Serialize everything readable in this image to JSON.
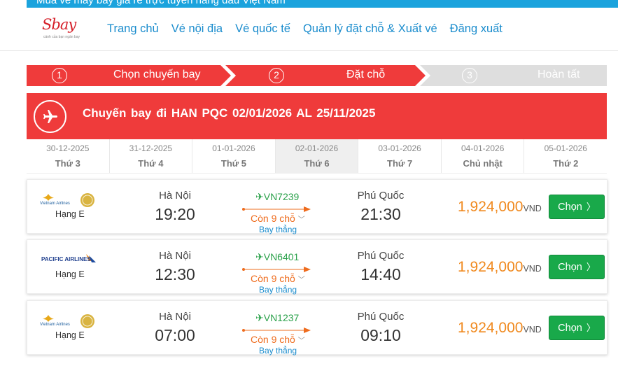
{
  "top_strip": {
    "text": "Mua vé máy bay giá rẻ trực tuyến hàng đầu Việt Nam"
  },
  "header": {
    "logo_text": "Sbay",
    "logo_sub": "cánh của bạn ngàn bay",
    "nav": [
      "Trang chủ",
      "Vé nội địa",
      "Vé quốc tế",
      "Quản lý đặt chỗ & Xuất vé",
      "Đăng xuất"
    ]
  },
  "steps": [
    {
      "num": "1",
      "label": "Chọn chuyến bay",
      "state": "active"
    },
    {
      "num": "2",
      "label": "Đặt chỗ",
      "state": "active"
    },
    {
      "num": "3",
      "label": "Hoàn tất",
      "state": "inactive"
    }
  ],
  "banner": {
    "title": "Chuyến bay đi HAN  PQC  02/01/2026  AL 25/11/2025"
  },
  "dates": [
    {
      "date": "30-12-2025",
      "weekday": "Thứ 3",
      "active": false
    },
    {
      "date": "31-12-2025",
      "weekday": "Thứ 4",
      "active": false
    },
    {
      "date": "01-01-2026",
      "weekday": "Thứ 5",
      "active": false
    },
    {
      "date": "02-01-2026",
      "weekday": "Thứ 6",
      "active": true
    },
    {
      "date": "03-01-2026",
      "weekday": "Thứ 7",
      "active": false
    },
    {
      "date": "04-01-2026",
      "weekday": "Chủ nhật",
      "active": false
    },
    {
      "date": "05-01-2026",
      "weekday": "Thứ 2",
      "active": false
    }
  ],
  "flights": [
    {
      "airline": "Vietnam Airlines",
      "logo": "vietnam-airlines-logo",
      "class": "Hạng E",
      "from": "Hà Nội",
      "dep_time": "19:20",
      "code": "VN7239",
      "seats": "Còn 9 chỗ",
      "stops": "Bay thẳng",
      "to": "Phú Quốc",
      "arr_time": "21:30",
      "price": "1,924,000",
      "currency": "VND",
      "button": "Chọn"
    },
    {
      "airline": "Pacific Airlines",
      "logo": "pacific-airlines-logo",
      "class": "Hạng E",
      "from": "Hà Nội",
      "dep_time": "12:30",
      "code": "VN6401",
      "seats": "Còn 9 chỗ",
      "stops": "Bay thẳng",
      "to": "Phú Quốc",
      "arr_time": "14:40",
      "price": "1,924,000",
      "currency": "VND",
      "button": "Chọn"
    },
    {
      "airline": "Vietnam Airlines",
      "logo": "vietnam-airlines-logo",
      "class": "Hạng E",
      "from": "Hà Nội",
      "dep_time": "07:00",
      "code": "VN1237",
      "seats": "Còn 9 chỗ",
      "stops": "Bay thẳng",
      "to": "Phú Quốc",
      "arr_time": "09:10",
      "price": "1,924,000",
      "currency": "VND",
      "button": "Chọn"
    }
  ],
  "colors": {
    "brand_red": "#ef3b3b",
    "link_blue": "#1a8ccd",
    "price_orange": "#f0891e",
    "button_green": "#19a94a",
    "flight_green": "#2aa14a"
  }
}
